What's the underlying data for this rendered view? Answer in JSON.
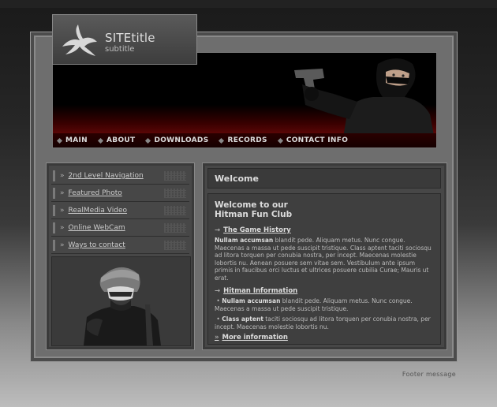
{
  "site": {
    "title": "SITEtitle",
    "subtitle": "subtitle"
  },
  "nav": [
    {
      "label": "MAIN"
    },
    {
      "label": "ABOUT"
    },
    {
      "label": "DOWNLOADS"
    },
    {
      "label": "RECORDS"
    },
    {
      "label": "CONTACT INFO"
    }
  ],
  "sidebar": [
    {
      "label": "2nd Level Navigation"
    },
    {
      "label": "Featured Photo"
    },
    {
      "label": "RealMedia Video"
    },
    {
      "label": "Online WebCam"
    },
    {
      "label": "Ways to contact"
    }
  ],
  "welcome": {
    "bar": "Welcome",
    "heading_line1": "Welcome to our",
    "heading_line2": "Hitman Fun Club"
  },
  "section1": {
    "title": "The Game History",
    "lead": "Nullam accumsan",
    "text": " blandit pede. Aliquam metus. Nunc congue. Maecenas a massa ut pede suscipit tristique. Class aptent taciti sociosqu ad litora torquen per conubia nostra, per incept. Maecenas molestie lobortis nu. Aenean posuere sem vitae sem. Vestibulum ante ipsum primis in faucibus orci luctus et ultrices posuere cubilia Curae; Mauris ut erat."
  },
  "section2": {
    "title": "Hitman Information",
    "b1_lead": "Nullam accumsan",
    "b1_text": " blandit pede. Aliquam metus. Nunc congue. Maecenas a massa ut pede suscipit tristique.",
    "b2_lead": "Class aptent",
    "b2_text": " taciti sociosqu ad litora torquen per conubia nostra, per incept. Maecenas molestie lobortis nu."
  },
  "more": {
    "label": "More information"
  },
  "footer": {
    "message": "Footer message"
  }
}
